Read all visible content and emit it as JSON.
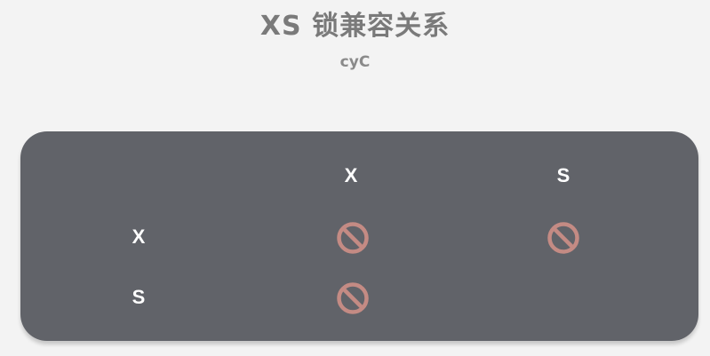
{
  "title": "XS 锁兼容关系",
  "subtitle": "cyC",
  "matrix": {
    "columns": [
      "X",
      "S"
    ],
    "rows": [
      {
        "label": "X",
        "cells": [
          "incompatible",
          "incompatible"
        ]
      },
      {
        "label": "S",
        "cells": [
          "incompatible",
          "compatible"
        ]
      }
    ]
  },
  "icon": {
    "name": "no-entry-icon",
    "color": "#c48b84"
  },
  "colors": {
    "background": "#f3f3f3",
    "card": "#616369",
    "title": "#7a7a7a",
    "header_text": "#ffffff"
  }
}
